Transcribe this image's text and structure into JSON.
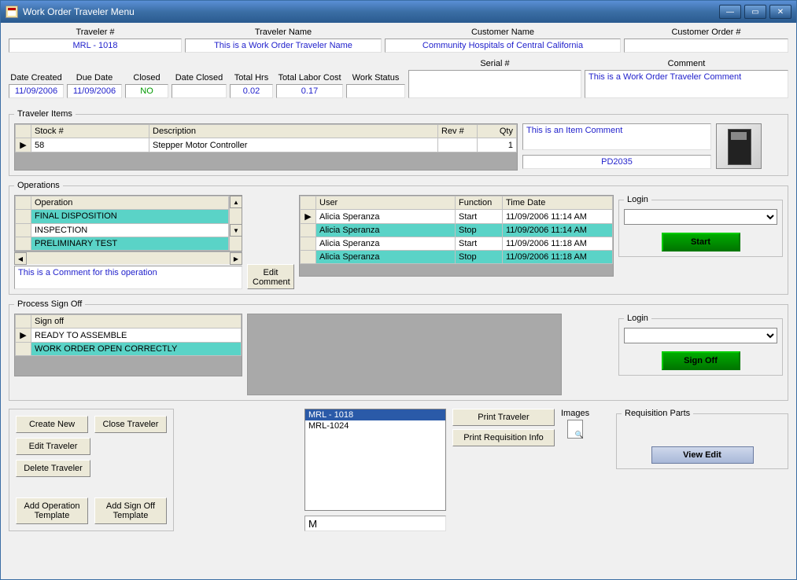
{
  "window": {
    "title": "Work Order Traveler Menu"
  },
  "header": {
    "traveler_num_label": "Traveler #",
    "traveler_num": "MRL - 1018",
    "traveler_name_label": "Traveler Name",
    "traveler_name": "This is a Work Order Traveler Name",
    "customer_name_label": "Customer Name",
    "customer_name": "Community Hospitals of Central California",
    "customer_order_label": "Customer Order #",
    "customer_order": ""
  },
  "info": {
    "date_created_label": "Date Created",
    "date_created": "11/09/2006",
    "due_date_label": "Due Date",
    "due_date": "11/09/2006",
    "closed_label": "Closed",
    "closed": "NO",
    "date_closed_label": "Date Closed",
    "date_closed": "",
    "total_hrs_label": "Total Hrs",
    "total_hrs": "0.02",
    "total_labor_cost_label": "Total Labor Cost",
    "total_labor_cost": "0.17",
    "work_status_label": "Work Status",
    "work_status": "",
    "serial_label": "Serial #",
    "serial": "",
    "comment_label": "Comment",
    "comment": "This is a Work Order Traveler Comment"
  },
  "items": {
    "legend": "Traveler Items",
    "cols": {
      "stock": "Stock #",
      "desc": "Description",
      "rev": "Rev #",
      "qty": "Qty"
    },
    "rows": [
      {
        "stock": "58",
        "desc": "Stepper Motor Controller",
        "rev": "",
        "qty": "1"
      }
    ],
    "item_comment": "This is an Item Comment",
    "part_number": "PD2035"
  },
  "operations": {
    "legend": "Operations",
    "col_operation": "Operation",
    "ops": [
      "FINAL DISPOSITION",
      "INSPECTION",
      "PRELIMINARY TEST"
    ],
    "op_comment": "This is a Comment for this operation",
    "edit_comment_btn": "Edit Comment",
    "log_cols": {
      "user": "User",
      "function": "Function",
      "timedate": "Time Date"
    },
    "log": [
      {
        "user": "Alicia Speranza",
        "func": "Start",
        "time": "11/09/2006 11:14 AM",
        "sel": false
      },
      {
        "user": "Alicia Speranza",
        "func": "Stop",
        "time": "11/09/2006 11:14 AM",
        "sel": true
      },
      {
        "user": "Alicia Speranza",
        "func": "Start",
        "time": "11/09/2006 11:18 AM",
        "sel": false
      },
      {
        "user": "Alicia Speranza",
        "func": "Stop",
        "time": "11/09/2006 11:18 AM",
        "sel": true
      }
    ],
    "login_legend": "Login",
    "start_btn": "Start"
  },
  "signoff": {
    "legend": "Process Sign Off",
    "col": "Sign off",
    "rows": [
      "READY TO ASSEMBLE",
      "WORK ORDER OPEN CORRECTLY"
    ],
    "login_legend": "Login",
    "signoff_btn": "Sign Off"
  },
  "footer": {
    "create_new": "Create New",
    "close_traveler": "Close Traveler",
    "edit_traveler": "Edit Traveler",
    "delete_traveler": "Delete Traveler",
    "add_op_template": "Add Operation Template",
    "add_signoff_template": "Add Sign Off Template",
    "list": [
      "MRL - 1018",
      "MRL-1024"
    ],
    "filter_value": "M",
    "print_traveler": "Print Traveler",
    "print_req_info": "Print Requisition Info",
    "images_label": "Images",
    "req_parts_legend": "Requisition Parts",
    "view_edit": "View Edit"
  }
}
